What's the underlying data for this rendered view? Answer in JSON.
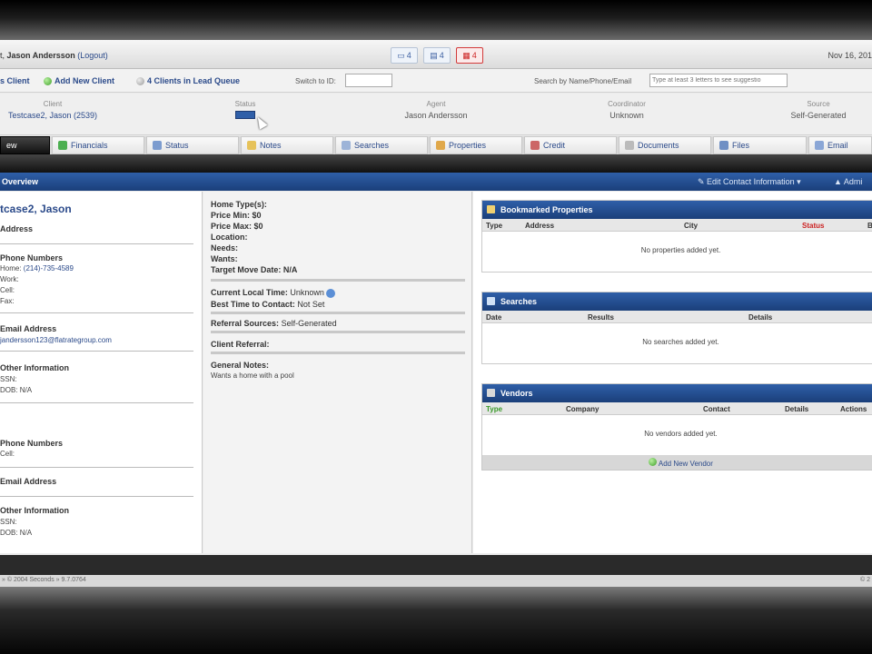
{
  "header": {
    "user_prefix": "t, ",
    "user_name": "Jason Andersson",
    "logout": "(Logout)",
    "icon_counts": [
      "4",
      "4",
      "4"
    ],
    "date": "Nov 16, 201"
  },
  "toolbar": {
    "add_client": "s Client",
    "add_new_client": "Add New Client",
    "clients_in_lead_queue": "4 Clients in Lead Queue",
    "switch_to_label": "Switch to ID:",
    "search_label": "Search by Name/Phone/Email",
    "search_placeholder": "Type at least 3 letters to see suggestio"
  },
  "summary": {
    "client_label": "Client",
    "client_value": "Testcase2, Jason (2539)",
    "status_label": "Status",
    "agent_label": "Agent",
    "agent_value": "Jason Andersson",
    "coordinator_label": "Coordinator",
    "coordinator_value": "Unknown",
    "source_label": "Source",
    "source_value": "Self-Generated"
  },
  "tabs": [
    "ew",
    "Financials",
    "Status",
    "Notes",
    "Searches",
    "Properties",
    "Credit",
    "Documents",
    "Files",
    "Email"
  ],
  "overview": {
    "title": "Overview",
    "edit_contact": "Edit Contact Information",
    "admin": "Admi"
  },
  "left": {
    "client_name": "tcase2, Jason",
    "address_title": "Address",
    "phone_title": "Phone Numbers",
    "home": "Home:",
    "home_value": "(214)-735-4589",
    "work": "Work:",
    "cell": "Cell:",
    "fax": "Fax:",
    "email_title": "Email Address",
    "email_value": "jandersson123@flatrategroup.com",
    "other_title": "Other Information",
    "ssn": "SSN:",
    "dob": "DOB: N/A",
    "phone_title2": "Phone Numbers",
    "cell2": "Cell:",
    "email_title2": "Email Address",
    "other_title2": "Other Information",
    "ssn2": "SSN:",
    "dob2": "DOB: N/A"
  },
  "middle": {
    "home_types": "Home Type(s):",
    "price_min": "Price Min: $0",
    "price_max": "Price Max: $0",
    "location": "Location:",
    "needs": "Needs:",
    "wants": "Wants:",
    "target_move": "Target Move Date: N/A",
    "current_time_label": "Current Local Time:",
    "current_time_value": "Unknown",
    "best_time_label": "Best Time to Contact:",
    "best_time_value": "Not Set",
    "referral_label": "Referral Sources:",
    "referral_value": "Self-Generated",
    "client_referral": "Client Referral:",
    "general_notes_label": "General Notes:",
    "general_notes_value": "Wants a home with a pool"
  },
  "bookmarked": {
    "title": "Bookmarked Properties",
    "cols": [
      "Type",
      "Address",
      "City",
      "Status",
      "Be"
    ],
    "empty": "No properties added yet."
  },
  "searches": {
    "title": "Searches",
    "cols": [
      "Date",
      "Results",
      "Details"
    ],
    "empty": "No searches added yet."
  },
  "vendors": {
    "title": "Vendors",
    "cols": [
      "Type",
      "Company",
      "Contact",
      "Details",
      "Actions"
    ],
    "empty": "No vendors added yet.",
    "add": "Add New Vendor"
  },
  "footer": {
    "copyright": "© 2004 Seconds",
    "version": "9.7.0764",
    "right": "© 2"
  },
  "colors": {
    "accent_blue": "#2f5fa8",
    "status_red": "#cc2222"
  }
}
